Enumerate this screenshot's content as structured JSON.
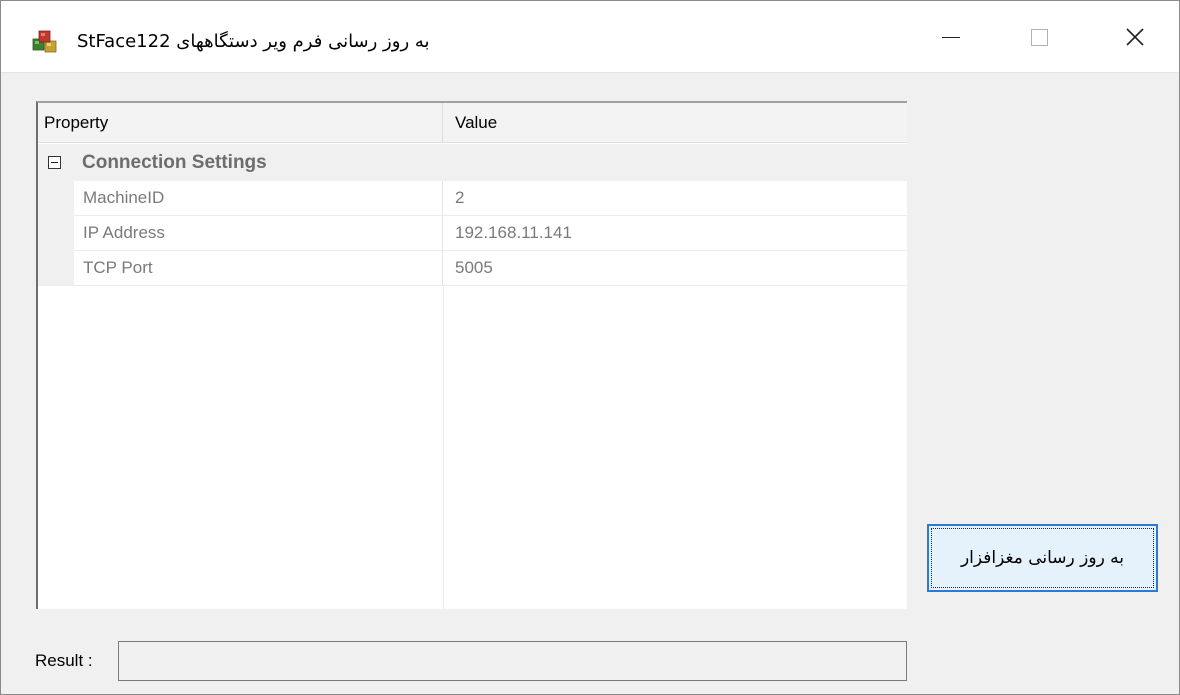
{
  "window": {
    "title": "به روز رسانی فرم ویر دستگاههای StFace122",
    "icon": "app-cubes-icon",
    "controls": {
      "minimize": "minimize-icon",
      "maximize": "maximize-icon",
      "close": "close-icon"
    }
  },
  "property_grid": {
    "columns": {
      "property": "Property",
      "value": "Value"
    },
    "category": {
      "label": "Connection Settings",
      "expanded": true
    },
    "rows": [
      {
        "name": "MachineID",
        "value": "2"
      },
      {
        "name": "IP Address",
        "value": "192.168.11.141"
      },
      {
        "name": "TCP Port",
        "value": "5005"
      }
    ]
  },
  "update_button": {
    "label": "به روز رسانی مغزافزار"
  },
  "result": {
    "label": "Result :",
    "value": ""
  },
  "colors": {
    "accent": "#2c7ad6",
    "button_bg": "#e5f1fb",
    "window_bg": "#f0f0f0",
    "muted_text": "#7a7a7a"
  }
}
